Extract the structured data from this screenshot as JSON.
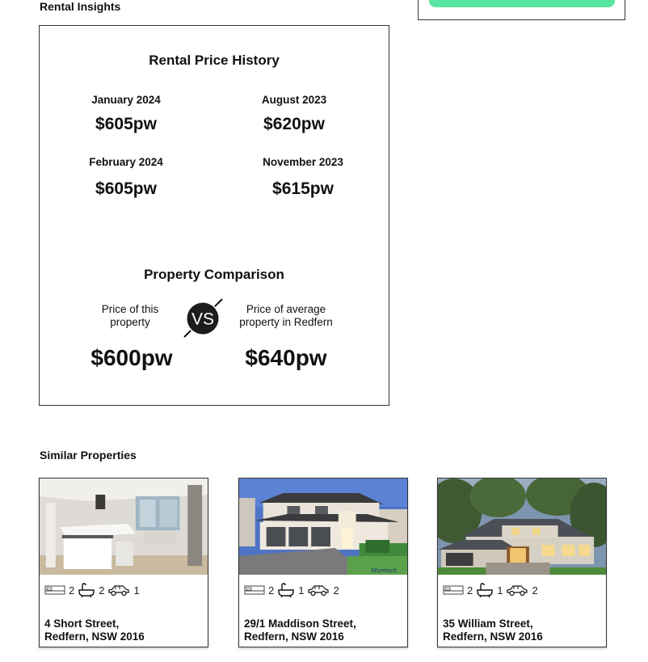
{
  "sections": {
    "rental_insights": "Rental Insights",
    "similar_properties": "Similar Properties"
  },
  "price_history": {
    "title": "Rental Price History",
    "entries": [
      {
        "period": "January 2024",
        "price": "$605pw"
      },
      {
        "period": "August 2023",
        "price": "$620pw"
      },
      {
        "period": "February 2024",
        "price": "$605pw"
      },
      {
        "period": "November 2023",
        "price": "$615pw"
      }
    ]
  },
  "comparison": {
    "title": "Property Comparison",
    "this_label": "Price of this property",
    "this_price": "$600pw",
    "vs": "VS",
    "average_label": "Price of average property in Redfern",
    "average_price": "$640pw"
  },
  "properties": [
    {
      "image": "apartment-interior-photo",
      "beds": "2",
      "baths": "2",
      "cars": "1",
      "address_line1": "4 Short Street,",
      "address_line2": "Redfern, NSW 2016"
    },
    {
      "image": "house-exterior-photo",
      "beds": "2",
      "baths": "1",
      "cars": "2",
      "address_line1": "29/1 Maddison Street,",
      "address_line2": "Redfern, NSW 2016",
      "watermark": "Murdoch"
    },
    {
      "image": "house-exterior-dusk-photo",
      "beds": "2",
      "baths": "1",
      "cars": "2",
      "address_line1": "35 William Street,",
      "address_line2": "Redfern, NSW 2016"
    }
  ],
  "colors": {
    "accent_button": "#57e6a1",
    "border": "#333333"
  }
}
